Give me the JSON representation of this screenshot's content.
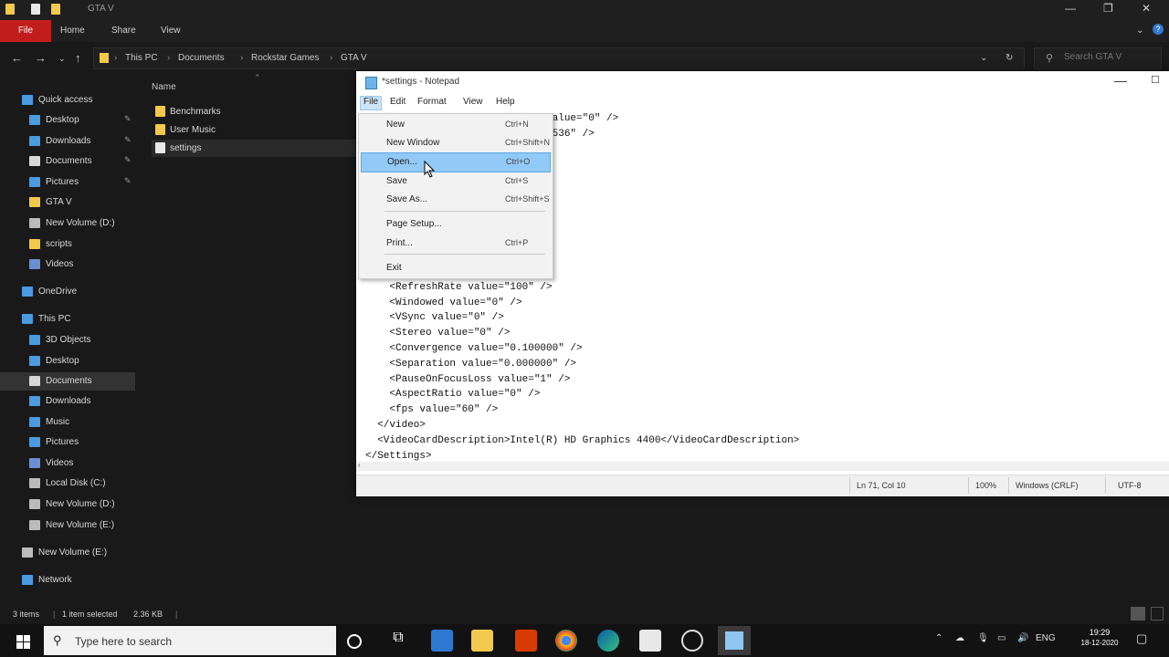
{
  "explorer": {
    "title": "GTA V",
    "window_controls": [
      "—",
      "❐",
      "✕"
    ],
    "ribbon": {
      "file": "File",
      "tabs": [
        "Home",
        "Share",
        "View"
      ]
    },
    "breadcrumb": [
      "This PC",
      "Documents",
      "Rockstar Games",
      "GTA V"
    ],
    "search_placeholder": "Search GTA V",
    "column_header": "Name",
    "files": [
      {
        "name": "Benchmarks",
        "type": "folder"
      },
      {
        "name": "User Music",
        "type": "folder"
      },
      {
        "name": "settings",
        "type": "file"
      }
    ],
    "sidebar": [
      {
        "label": "Quick access",
        "icon": "star-icon",
        "pinned": false
      },
      {
        "label": "Desktop",
        "icon": "desktop-icon",
        "pinned": true
      },
      {
        "label": "Downloads",
        "icon": "download-icon",
        "pinned": true
      },
      {
        "label": "Documents",
        "icon": "document-icon",
        "pinned": true
      },
      {
        "label": "Pictures",
        "icon": "picture-icon",
        "pinned": true
      },
      {
        "label": "GTA V",
        "icon": "folder-icon",
        "pinned": false
      },
      {
        "label": "New Volume (D:)",
        "icon": "drive-icon",
        "pinned": false
      },
      {
        "label": "scripts",
        "icon": "folder-icon",
        "pinned": false
      },
      {
        "label": "Videos",
        "icon": "video-icon",
        "pinned": false
      },
      {
        "label": "OneDrive",
        "icon": "cloud-icon",
        "pinned": false
      },
      {
        "label": "This PC",
        "icon": "computer-icon",
        "pinned": false
      },
      {
        "label": "3D Objects",
        "icon": "cube-icon",
        "pinned": false
      },
      {
        "label": "Desktop",
        "icon": "desktop-icon",
        "pinned": false
      },
      {
        "label": "Documents",
        "icon": "document-icon",
        "pinned": false
      },
      {
        "label": "Downloads",
        "icon": "download-icon",
        "pinned": false
      },
      {
        "label": "Music",
        "icon": "music-icon",
        "pinned": false
      },
      {
        "label": "Pictures",
        "icon": "picture-icon",
        "pinned": false
      },
      {
        "label": "Videos",
        "icon": "video-icon",
        "pinned": false
      },
      {
        "label": "Local Disk (C:)",
        "icon": "drive-icon",
        "pinned": false
      },
      {
        "label": "New Volume (D:)",
        "icon": "drive-icon",
        "pinned": false
      },
      {
        "label": "New Volume (E:)",
        "icon": "drive-icon",
        "pinned": false
      },
      {
        "label": "New Volume (E:)",
        "icon": "drive-icon",
        "pinned": false
      },
      {
        "label": "Network",
        "icon": "network-icon",
        "pinned": false
      }
    ],
    "status": {
      "items": "3 items",
      "selected": "1 item selected",
      "size": "2.36 KB"
    }
  },
  "notepad": {
    "title": "*settings - Notepad",
    "menu": [
      "File",
      "Edit",
      "Format",
      "View",
      "Help"
    ],
    "lines": [
      "                            y value=\"0\" />",
      "                            \"65536\" />",
      "",
      "                            />",
      "                            >",
      "",
      "",
      "                            />",
      "                            />",
      "                            />",
      "                          \" />",
      "    <RefreshRate value=\"100\" />",
      "    <Windowed value=\"0\" />",
      "    <VSync value=\"0\" />",
      "    <Stereo value=\"0\" />",
      "    <Convergence value=\"0.100000\" />",
      "    <Separation value=\"0.000000\" />",
      "    <PauseOnFocusLoss value=\"1\" />",
      "    <AspectRatio value=\"0\" />",
      "    <fps value=\"60\" />",
      "  </video>",
      "  <VideoCardDescription>Intel(R) HD Graphics 4400</VideoCardDescription>",
      "</Settings>"
    ],
    "status": {
      "position": "Ln 71, Col 10",
      "zoom": "100%",
      "eol": "Windows (CRLF)",
      "encoding": "UTF-8"
    }
  },
  "file_menu": [
    {
      "label": "New",
      "shortcut": "Ctrl+N"
    },
    {
      "label": "New Window",
      "shortcut": "Ctrl+Shift+N"
    },
    {
      "label": "Open...",
      "shortcut": "Ctrl+O",
      "highlight": true
    },
    {
      "label": "Save",
      "shortcut": "Ctrl+S"
    },
    {
      "label": "Save As...",
      "shortcut": "Ctrl+Shift+S"
    },
    {
      "label": "Page Setup...",
      "shortcut": ""
    },
    {
      "label": "Print...",
      "shortcut": "Ctrl+P"
    },
    {
      "label": "Exit",
      "shortcut": ""
    }
  ],
  "taskbar": {
    "search_placeholder": "Type here to search",
    "time": "19:29",
    "date": "18-12-2020",
    "language": "ENG",
    "apps": [
      "cortana-icon",
      "task-view-icon",
      "mail-icon",
      "file-explorer-icon",
      "office-icon",
      "chrome-icon",
      "edge-icon",
      "store-icon",
      "obs-icon",
      "notepad-icon"
    ]
  },
  "colors": {
    "file_tab": "#c21d1d",
    "highlight": "#91c9f7",
    "folder": "#f2c94c",
    "sidebar_icon": "#4a9be0"
  }
}
